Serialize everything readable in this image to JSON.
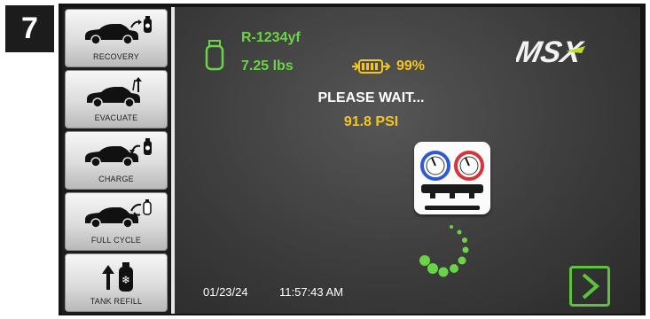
{
  "step_badge": "7",
  "sidebar": {
    "items": [
      {
        "label": "RECOVERY",
        "icon": "car-recovery-icon"
      },
      {
        "label": "EVACUATE",
        "icon": "car-evacuate-icon"
      },
      {
        "label": "CHARGE",
        "icon": "car-charge-icon"
      },
      {
        "label": "FULL CYCLE",
        "icon": "car-full-cycle-icon"
      },
      {
        "label": "TANK REFILL",
        "icon": "tank-refill-icon"
      }
    ]
  },
  "status": {
    "refrigerant": "R-1234yf",
    "tank_weight": "7.25 lbs",
    "battery_percent": "99%",
    "message": "PLEASE WAIT...",
    "pressure": "91.8 PSI",
    "date": "01/23/24",
    "time": "11:57:43 AM"
  },
  "brand": {
    "logo_text": "MSX"
  },
  "nav": {
    "next_icon": "chevron-right-icon"
  },
  "colors": {
    "accent_green": "#6ad447",
    "accent_yellow": "#f4c51c",
    "screen_bg": "#3c3c3c",
    "gauge_low": "#2e5ad8",
    "gauge_high": "#d8323a"
  }
}
